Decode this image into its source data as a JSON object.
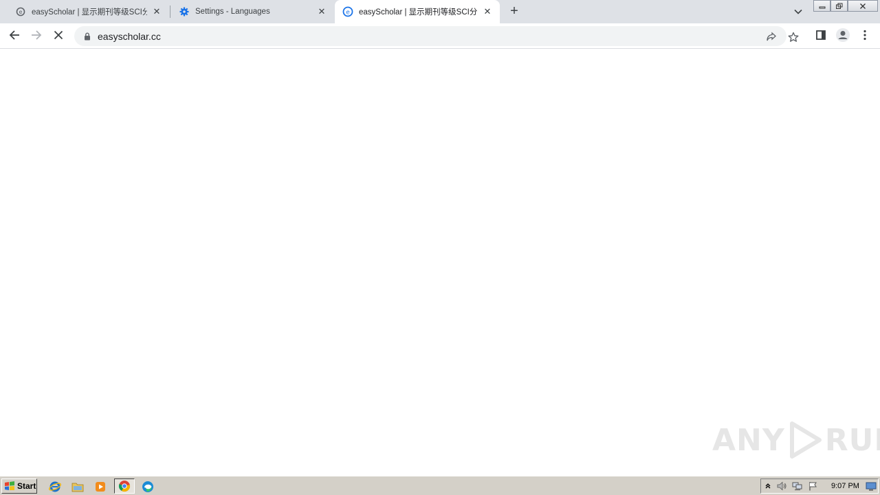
{
  "browser": {
    "tabs": [
      {
        "title": "easyScholar | 显示期刊等级SCI分区",
        "active": false,
        "icon": "easyscholar-icon"
      },
      {
        "title": "Settings - Languages",
        "active": false,
        "icon": "gear-icon"
      },
      {
        "title": "easyScholar | 显示期刊等级SCI分区",
        "active": true,
        "icon": "easyscholar-icon"
      }
    ],
    "new_tab_label": "+",
    "omnibox": {
      "url": "easyscholar.cc"
    },
    "toolbar_icons": [
      "back-icon",
      "forward-icon",
      "stop-loading-icon",
      "share-icon",
      "bookmark-star-icon",
      "side-panel-icon",
      "profile-icon",
      "menu-icon"
    ],
    "colors": {
      "tabstrip": "#dee1e6",
      "omnibox": "#f1f3f4",
      "accent": "#1a73e8"
    }
  },
  "watermark": {
    "left_text": "ANY",
    "right_text": "RUN"
  },
  "taskbar": {
    "start_label": "Start",
    "pinned": [
      "ie-icon",
      "explorer-icon",
      "media-player-icon",
      "chrome-icon",
      "edge-icon"
    ],
    "clock": "9:07 PM"
  }
}
